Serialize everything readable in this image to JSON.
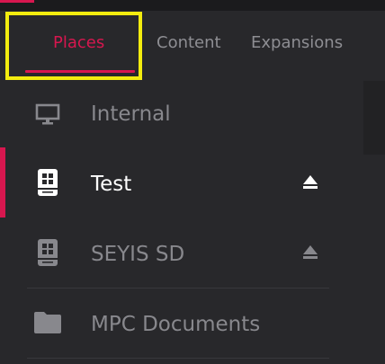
{
  "tabs": [
    {
      "label": "Places",
      "active": true
    },
    {
      "label": "Content",
      "active": false
    },
    {
      "label": "Expansions",
      "active": false
    }
  ],
  "places": [
    {
      "label": "Internal",
      "icon": "monitor-icon",
      "active": false,
      "ejectable": false
    },
    {
      "label": "Test",
      "icon": "drive-icon",
      "active": true,
      "ejectable": true
    },
    {
      "label": "SEYIS SD",
      "icon": "drive-icon",
      "active": false,
      "ejectable": true
    },
    {
      "label": "MPC Documents",
      "icon": "folder-icon",
      "active": false,
      "ejectable": false
    }
  ],
  "colors": {
    "accent": "#d7174f",
    "highlight": "#f3ec0f",
    "background": "#28282b",
    "inactive_text": "#88888d",
    "active_text": "#ffffff"
  }
}
